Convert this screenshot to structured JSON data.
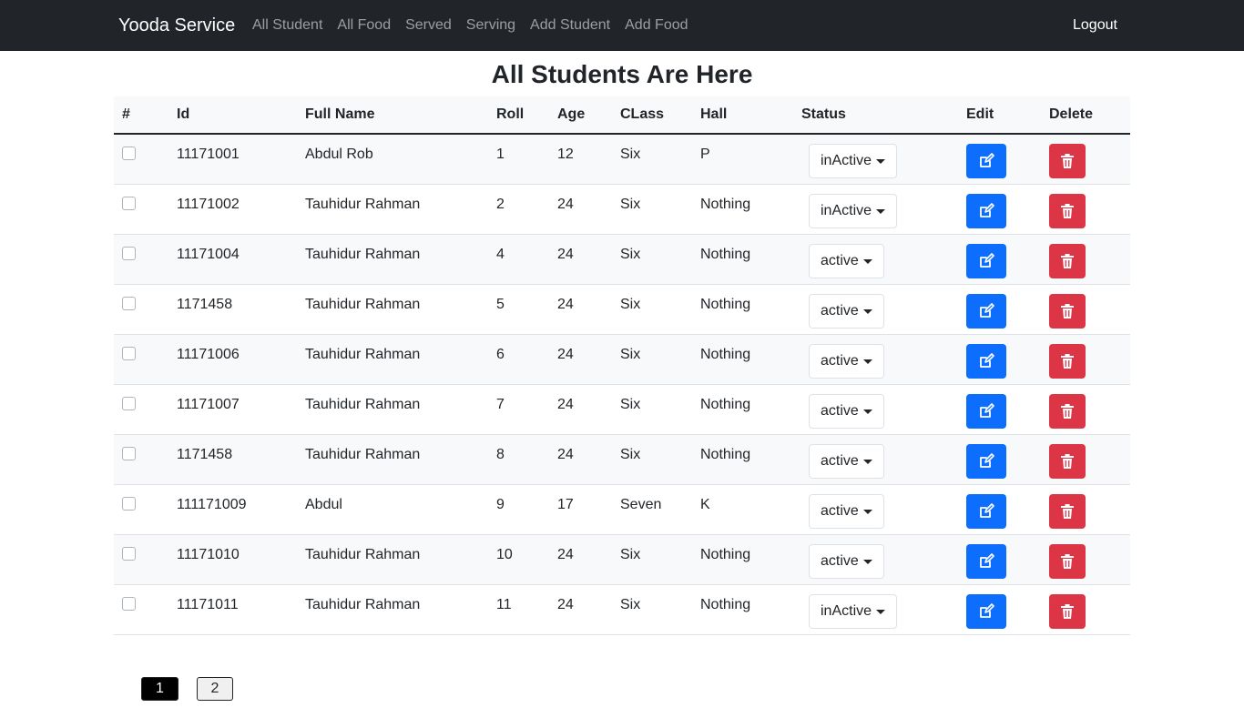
{
  "navbar": {
    "brand": "Yooda Service",
    "links": [
      "All Student",
      "All Food",
      "Served",
      "Serving",
      "Add Student",
      "Add Food"
    ],
    "logout": "Logout"
  },
  "page_title": "All Students Are Here",
  "table": {
    "headers": [
      "#",
      "Id",
      "Full Name",
      "Roll",
      "Age",
      "CLass",
      "Hall",
      "Status",
      "Edit",
      "Delete"
    ],
    "rows": [
      {
        "id": "11171001",
        "name": "Abdul Rob",
        "roll": "1",
        "age": "12",
        "class": "Six",
        "hall": "P",
        "status": "inActive"
      },
      {
        "id": "11171002",
        "name": "Tauhidur Rahman",
        "roll": "2",
        "age": "24",
        "class": "Six",
        "hall": "Nothing",
        "status": "inActive"
      },
      {
        "id": "11171004",
        "name": "Tauhidur Rahman",
        "roll": "4",
        "age": "24",
        "class": "Six",
        "hall": "Nothing",
        "status": "active"
      },
      {
        "id": "1171458",
        "name": "Tauhidur Rahman",
        "roll": "5",
        "age": "24",
        "class": "Six",
        "hall": "Nothing",
        "status": "active"
      },
      {
        "id": "11171006",
        "name": "Tauhidur Rahman",
        "roll": "6",
        "age": "24",
        "class": "Six",
        "hall": "Nothing",
        "status": "active"
      },
      {
        "id": "11171007",
        "name": "Tauhidur Rahman",
        "roll": "7",
        "age": "24",
        "class": "Six",
        "hall": "Nothing",
        "status": "active"
      },
      {
        "id": "1171458",
        "name": "Tauhidur Rahman",
        "roll": "8",
        "age": "24",
        "class": "Six",
        "hall": "Nothing",
        "status": "active"
      },
      {
        "id": "111171009",
        "name": "Abdul",
        "roll": "9",
        "age": "17",
        "class": "Seven",
        "hall": "K",
        "status": "active"
      },
      {
        "id": "11171010",
        "name": "Tauhidur Rahman",
        "roll": "10",
        "age": "24",
        "class": "Six",
        "hall": "Nothing",
        "status": "active"
      },
      {
        "id": "11171011",
        "name": "Tauhidur Rahman",
        "roll": "11",
        "age": "24",
        "class": "Six",
        "hall": "Nothing",
        "status": "inActive"
      }
    ]
  },
  "pagination": [
    "1",
    "2"
  ],
  "colors": {
    "navbar": "#212529",
    "edit": "#0d6efd",
    "delete": "#dc3545",
    "active_page": "#000000"
  },
  "icons": {
    "edit": "edit-icon",
    "delete": "trash-icon"
  }
}
